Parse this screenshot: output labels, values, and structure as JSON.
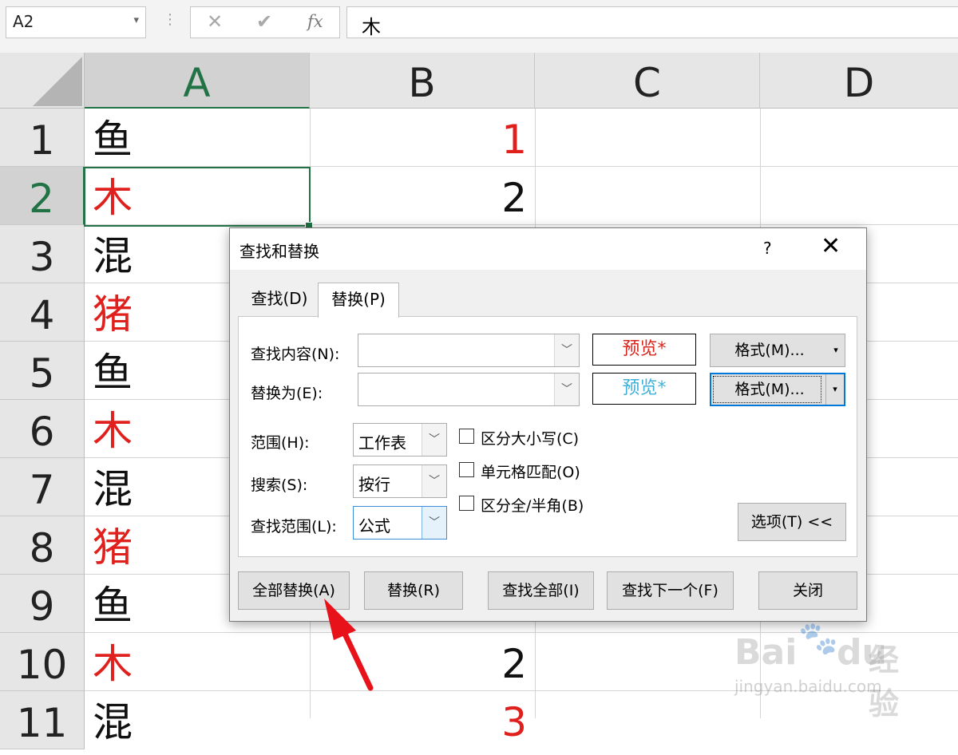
{
  "formula_bar": {
    "name_box": "A2",
    "cancel_glyph": "✕",
    "confirm_glyph": "✔",
    "fx_label": "fx",
    "value": "木"
  },
  "sheet": {
    "columns": [
      "A",
      "B",
      "C",
      "D"
    ],
    "rows": [
      "1",
      "2",
      "3",
      "4",
      "5",
      "6",
      "7",
      "8",
      "9",
      "10",
      "11"
    ],
    "selected_cell": "A2",
    "col_a": [
      {
        "text": "鱼",
        "color": "black"
      },
      {
        "text": "木",
        "color": "red"
      },
      {
        "text": "混",
        "color": "black"
      },
      {
        "text": "猪",
        "color": "red"
      },
      {
        "text": "鱼",
        "color": "black"
      },
      {
        "text": "木",
        "color": "red"
      },
      {
        "text": "混",
        "color": "black"
      },
      {
        "text": "猪",
        "color": "red"
      },
      {
        "text": "鱼",
        "color": "black"
      },
      {
        "text": "木",
        "color": "red"
      },
      {
        "text": "混",
        "color": "black"
      }
    ],
    "col_b": [
      {
        "row": 1,
        "text": "1",
        "color": "red"
      },
      {
        "row": 2,
        "text": "2",
        "color": "black"
      },
      {
        "row": 10,
        "text": "2",
        "color": "black"
      },
      {
        "row": 11,
        "text": "3",
        "color": "red"
      }
    ],
    "colors": {
      "red": "#e0201c",
      "accent": "#217346"
    }
  },
  "dialog": {
    "title": "查找和替换",
    "help": "?",
    "close": "✕",
    "tabs": {
      "find": "查找(D)",
      "replace": "替换(P)"
    },
    "find_what_label": "查找内容(N):",
    "find_what_value": "",
    "replace_with_label": "替换为(E):",
    "replace_with_value": "",
    "preview_find": "预览*",
    "preview_replace": "预览*",
    "preview_find_color": "#d9261c",
    "preview_replace_color": "#3fb0d8",
    "format_button": "格式(M)...",
    "within_label": "范围(H):",
    "within_value": "工作表",
    "search_label": "搜索(S):",
    "search_value": "按行",
    "look_in_label": "查找范围(L):",
    "look_in_value": "公式",
    "match_case": "区分大小写(C)",
    "match_entire": "单元格匹配(O)",
    "match_byte": "区分全/半角(B)",
    "options_button": "选项(T) <<",
    "buttons": {
      "replace_all": "全部替换(A)",
      "replace": "替换(R)",
      "find_all": "查找全部(I)",
      "find_next": "查找下一个(F)",
      "close": "关闭"
    }
  },
  "watermark": {
    "brand": "Bai",
    "brand2": "du",
    "cn": "经验",
    "url": "jingyan.baidu.com"
  }
}
